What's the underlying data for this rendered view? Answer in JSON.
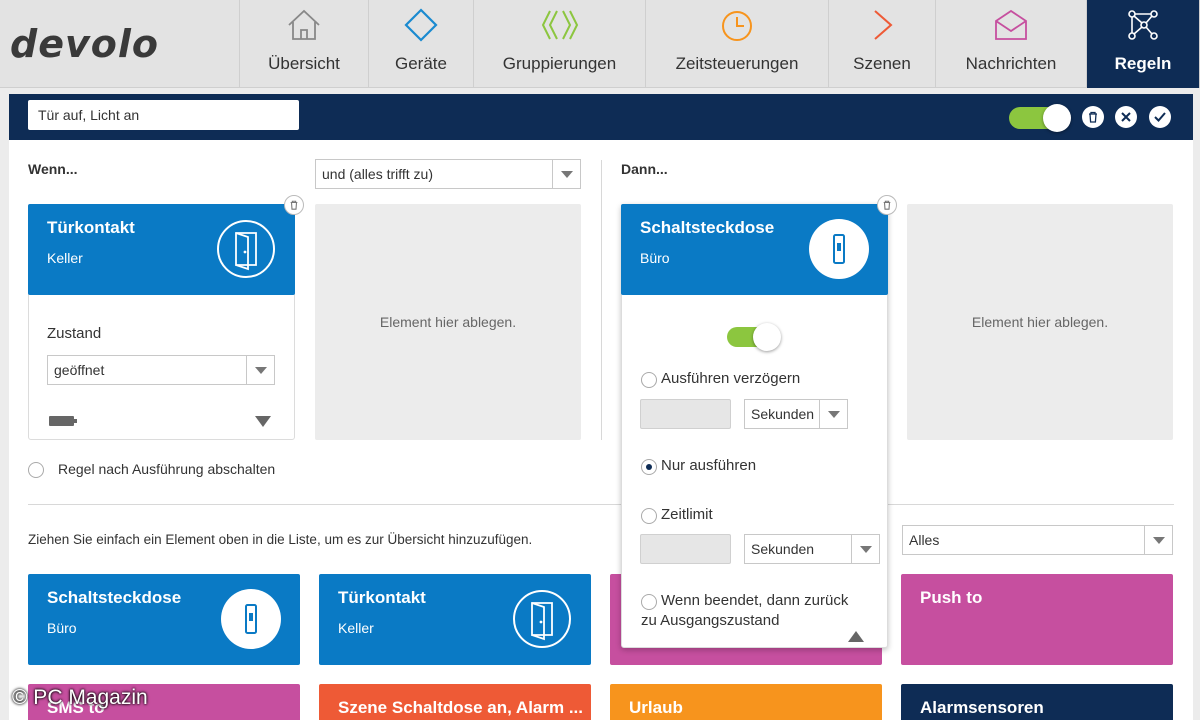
{
  "app": {
    "logo": "devolo"
  },
  "nav": [
    {
      "label": "Übersicht",
      "icon": "house-icon"
    },
    {
      "label": "Geräte",
      "icon": "diamond-icon"
    },
    {
      "label": "Gruppierungen",
      "icon": "group-icon"
    },
    {
      "label": "Zeitsteuerungen",
      "icon": "clock-icon"
    },
    {
      "label": "Szenen",
      "icon": "play-icon"
    },
    {
      "label": "Nachrichten",
      "icon": "envelope-icon"
    },
    {
      "label": "Regeln",
      "icon": "network-icon",
      "active": true
    }
  ],
  "rule": {
    "name": "Tür auf, Licht an",
    "enabled": true
  },
  "condition": {
    "heading": "Wenn...",
    "logic_select": "und (alles trifft zu)",
    "tile": {
      "title": "Türkontakt",
      "sub": "Keller"
    },
    "state_label": "Zustand",
    "state_select": "geöffnet",
    "dropzone": "Element hier ablegen.",
    "disable_after": "Regel nach Ausführung abschalten"
  },
  "action": {
    "heading": "Dann...",
    "tile": {
      "title": "Schaltsteckdose",
      "sub": "Büro"
    },
    "switch_on": true,
    "delay_label": "Ausführen verzögern",
    "delay_unit": "Sekunden",
    "only_run": "Nur ausführen",
    "timelimit": "Zeitlimit",
    "timelimit_unit": "Sekunden",
    "return_line1": "Wenn beendet, dann zurück",
    "return_line2": "zu Ausgangszustand",
    "dropzone": "Element hier ablegen."
  },
  "list": {
    "hint": "Ziehen Sie einfach ein Element oben in die Liste, um es zur Übersicht hinzuzufügen.",
    "filter": "Alles",
    "tiles": [
      {
        "title": "Schaltsteckdose",
        "sub": "Büro",
        "color": "#0a7ac5"
      },
      {
        "title": "Türkontakt",
        "sub": "Keller",
        "color": "#0a7ac5"
      },
      {
        "title": "",
        "sub": "",
        "color": "#c64f9f"
      },
      {
        "title": "Push to",
        "sub": "",
        "color": "#c64f9f"
      },
      {
        "title": "SMS to",
        "sub": "",
        "color": "#c64f9f"
      },
      {
        "title": "Szene Schaltdose an, Alarm ...",
        "sub": "",
        "color": "#ee5a36"
      },
      {
        "title": "Urlaub",
        "sub": "",
        "color": "#f7941d"
      },
      {
        "title": "Alarmsensoren",
        "sub": "",
        "color": "#0e2c55"
      }
    ]
  },
  "colors": {
    "navy": "#0e2c55",
    "blue": "#0a7ac5",
    "green": "#8cc63f",
    "magenta": "#c64f9f",
    "orange": "#f7941d",
    "red": "#ee5a36"
  },
  "watermark": "© PC Magazin"
}
